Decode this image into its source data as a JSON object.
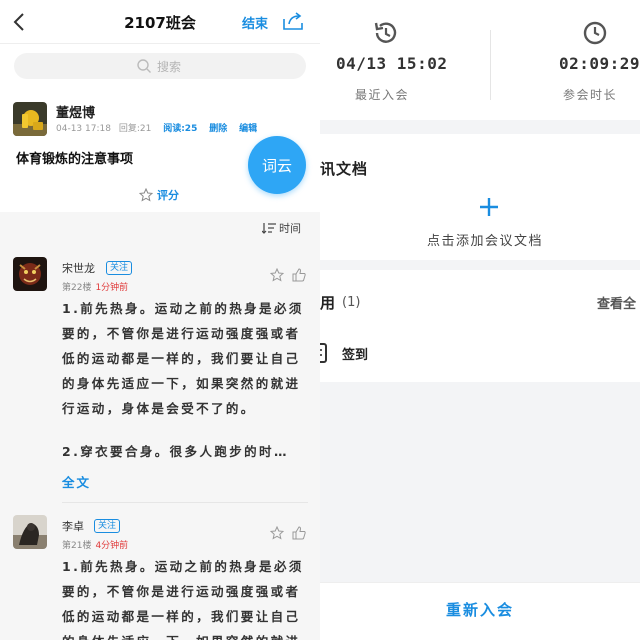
{
  "header": {
    "title": "2107班会",
    "end_label": "结束",
    "share_icon": "share-icon",
    "back_icon": "back-icon"
  },
  "search": {
    "placeholder": "搜索"
  },
  "post": {
    "author": "董煜博",
    "date": "04-13 17:18",
    "replies": "回复:21",
    "reads": "阅读:25",
    "delete_label": "删除",
    "edit_label": "编辑",
    "heading": "体育锻炼的注意事项",
    "rate_label": "评分",
    "wordcloud_label": "词云"
  },
  "sort_label": "时间",
  "comments": [
    {
      "name": "宋世龙",
      "follow_label": "关注",
      "floor": "第22楼",
      "time_ago": "1分钟前",
      "body": "1.前先热身。运动之前的热身是必须要的，不管你是进行运动强度强或者低的运动都是一样的，我们要让自己的身体先适应一下，如果突然的就进行运动，身体是会受不了的。",
      "body_2": "2.穿衣要合身。很多人跑步的时…",
      "fulltext_label": "全文"
    },
    {
      "name": "李卓",
      "follow_label": "关注",
      "floor": "第21楼",
      "time_ago": "4分钟前",
      "body": "1.前先热身。运动之前的热身是必须要的，不管你是进行运动强度强或者低的运动都是一样的，我们要让自己的身体先适应一下，如果突然的就进"
    }
  ],
  "stats": {
    "recent_join_value": "04/13 15:02",
    "recent_join_label": "最近入会",
    "duration_value": "02:09:29",
    "duration_label": "参会时长"
  },
  "docs": {
    "title_partial": "讯文档",
    "add_label": "点击添加会议文档"
  },
  "apps": {
    "title_partial": "用",
    "count": "(1)",
    "view_all_partial": "查看全",
    "item_label": "签到"
  },
  "rejoin_label": "重新入会",
  "colors": {
    "accent": "#1a8de0",
    "wordcloud": "#2ea6f5",
    "time_red": "#e03a3a"
  }
}
